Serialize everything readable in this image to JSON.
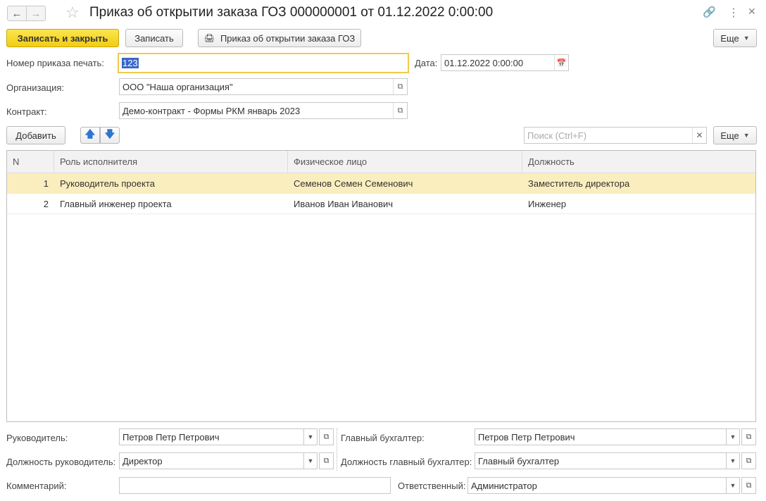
{
  "window": {
    "title": "Приказ об открытии заказа ГОЗ 000000001 от 01.12.2022 0:00:00"
  },
  "toolbar": {
    "save_close": "Записать и закрыть",
    "save": "Записать",
    "print_label": "Приказ об открытии заказа ГОЗ",
    "more": "Еще"
  },
  "form": {
    "order_number_label": "Номер приказа печать:",
    "order_number_value": "123",
    "date_label": "Дата:",
    "date_value": "01.12.2022  0:00:00",
    "organization_label": "Организация:",
    "organization_value": "ООО \"Наша организация\"",
    "contract_label": "Контракт:",
    "contract_value": "Демо-контракт - Формы РКМ январь 2023"
  },
  "table_toolbar": {
    "add": "Добавить",
    "search_placeholder": "Поиск (Ctrl+F)",
    "more": "Еще"
  },
  "table": {
    "columns": [
      "N",
      "Роль исполнителя",
      "Физическое лицо",
      "Должность"
    ],
    "rows": [
      {
        "n": "1",
        "role": "Руководитель проекта",
        "person": "Семенов Семен Семенович",
        "position": "Заместитель директора"
      },
      {
        "n": "2",
        "role": "Главный инженер проекта",
        "person": "Иванов Иван Иванович",
        "position": "Инженер"
      }
    ]
  },
  "footer": {
    "head_label": "Руководитель:",
    "head_value": "Петров Петр Петрович",
    "head_position_label": "Должность руководитель:",
    "head_position_value": "Директор",
    "accountant_label": "Главный бухгалтер:",
    "accountant_value": "Петров Петр Петрович",
    "accountant_position_label": "Должность главный бухгалтер:",
    "accountant_position_value": "Главный бухгалтер",
    "comment_label": "Комментарий:",
    "comment_value": "",
    "responsible_label": "Ответственный:",
    "responsible_value": "Администратор"
  }
}
